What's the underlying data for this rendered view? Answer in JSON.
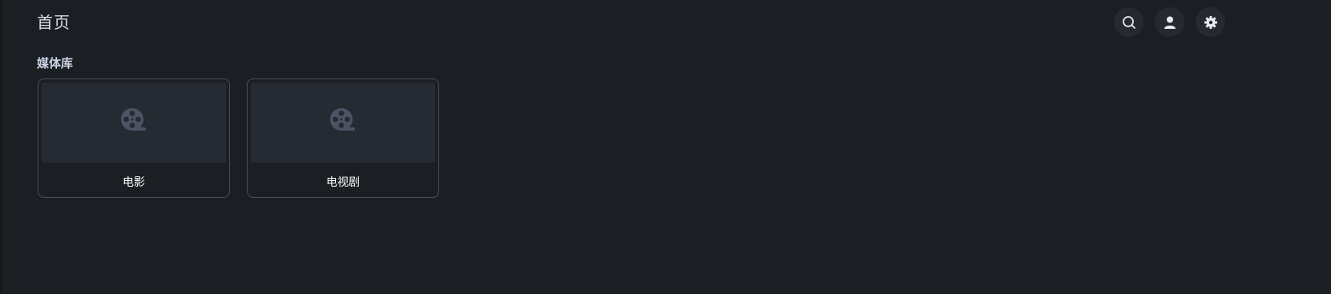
{
  "header": {
    "title": "首页",
    "actions": [
      {
        "name": "search",
        "icon": "search-icon"
      },
      {
        "name": "user",
        "icon": "user-icon"
      },
      {
        "name": "settings",
        "icon": "gear-icon"
      }
    ]
  },
  "libraries": {
    "section_title": "媒体库",
    "items": [
      {
        "label": "电影",
        "icon": "film-reel-icon"
      },
      {
        "label": "电视剧",
        "icon": "film-reel-icon"
      }
    ]
  },
  "colors": {
    "background": "#1b1e23",
    "card_thumb": "#262b33",
    "card_border": "#4a4f57",
    "icon_button_bg": "#262a30",
    "reel_icon": "#4c5463"
  }
}
